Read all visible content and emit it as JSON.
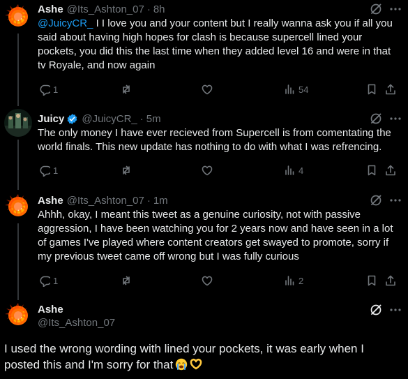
{
  "posts": [
    {
      "name": "Ashe",
      "handle": "@Its_Ashton_07",
      "time": "8h",
      "mention": "@JuicyCR_",
      "text": " I I love you and your content but I really wanna ask you if all you said about having high hopes for clash is because supercell lined your pockets, you did this the last time when they added level 16 and were in that tv Royale, and now again",
      "replies": "1",
      "reposts": "",
      "likes": "",
      "views": "54"
    },
    {
      "name": "Juicy",
      "handle": "@JuicyCR_",
      "time": "5m",
      "verified": true,
      "text": "The only money I have ever recieved from Supercell is from comentating the world finals. This new update has nothing to do with what I was refrencing.",
      "replies": "1",
      "reposts": "",
      "likes": "",
      "views": "4"
    },
    {
      "name": "Ashe",
      "handle": "@Its_Ashton_07",
      "time": "1m",
      "text": "Ahhh, okay, I meant this tweet as a genuine curiosity, not with passive aggression, I have been watching you for 2 years now and have seen in a lot of games I've played where content creators get swayed to promote, sorry if my previous tweet came off wrong but I was fully curious",
      "replies": "1",
      "reposts": "",
      "likes": "",
      "views": "2"
    }
  ],
  "main_post": {
    "name": "Ashe",
    "handle": "@Its_Ashton_07",
    "text": "I used the wrong wording with lined your pockets, it was early when I posted this and I'm sorry for that"
  },
  "icons": {
    "reply": "reply-icon",
    "repost": "repost-icon",
    "like": "like-icon",
    "views": "views-icon",
    "bookmark": "bookmark-icon",
    "share": "share-icon",
    "grok": "grok-icon",
    "more": "more-icon",
    "verified": "verified-badge-icon"
  },
  "colors": {
    "background": "#000000",
    "text": "#e7e9ea",
    "muted": "#71767b",
    "link": "#1d9bf0",
    "verified": "#1d9bf0"
  }
}
